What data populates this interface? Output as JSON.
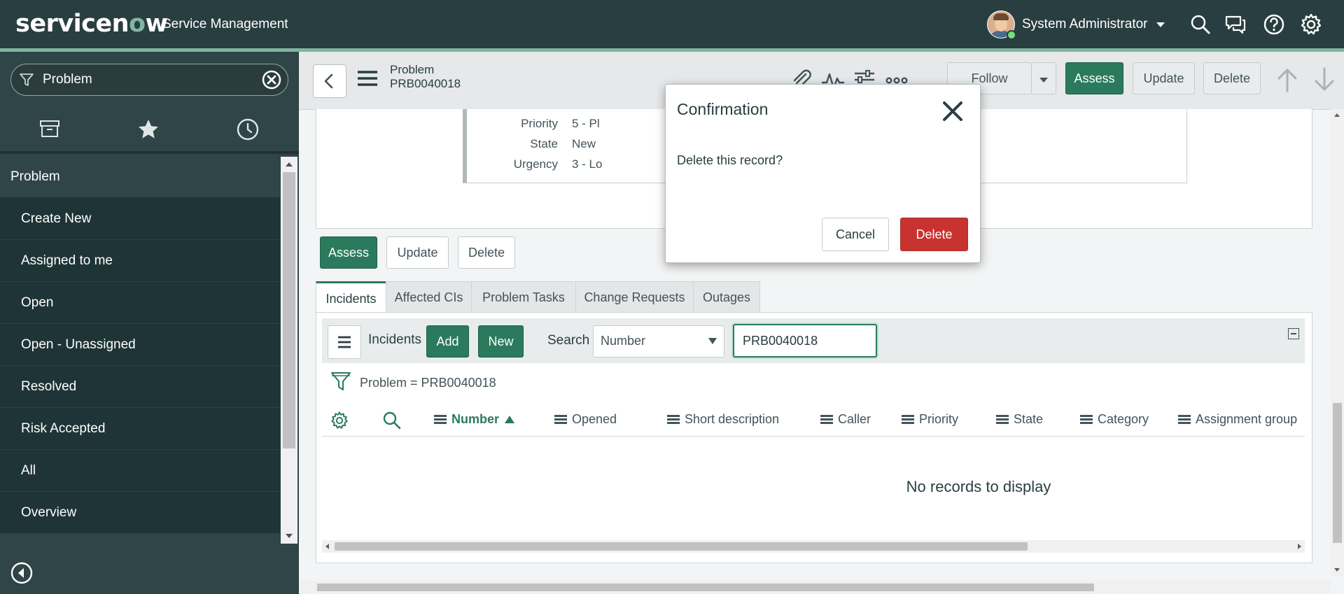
{
  "header": {
    "logo_text_pre": "servicen",
    "logo_text_o": "o",
    "logo_text_post": "w",
    "app_title": "Service Management",
    "user_name": "System Administrator"
  },
  "sidebar": {
    "filter_value": "Problem",
    "section_header": "Problem",
    "items": [
      {
        "label": "Create New"
      },
      {
        "label": "Assigned to me"
      },
      {
        "label": "Open"
      },
      {
        "label": "Open - Unassigned"
      },
      {
        "label": "Resolved"
      },
      {
        "label": "Risk Accepted"
      },
      {
        "label": "All"
      },
      {
        "label": "Overview"
      }
    ]
  },
  "record": {
    "table": "Problem",
    "number": "PRB0040018",
    "buttons": {
      "follow": "Follow",
      "assess": "Assess",
      "update": "Update",
      "delete": "Delete"
    },
    "fields": [
      {
        "label": "Priority",
        "value": "5 - Pl"
      },
      {
        "label": "State",
        "value": "New"
      },
      {
        "label": "Urgency",
        "value": "3 - Lo"
      }
    ]
  },
  "actions": {
    "assess": "Assess",
    "update": "Update",
    "delete": "Delete"
  },
  "related_tabs": [
    {
      "label": "Incidents"
    },
    {
      "label": "Affected CIs"
    },
    {
      "label": "Problem Tasks"
    },
    {
      "label": "Change Requests"
    },
    {
      "label": "Outages"
    }
  ],
  "list": {
    "title": "Incidents",
    "add_label": "Add",
    "new_label": "New",
    "search_label": "Search",
    "search_field": "Number",
    "search_value": "PRB0040018",
    "breadcrumb": "Problem = PRB0040018",
    "columns": [
      {
        "label": "Number"
      },
      {
        "label": "Opened"
      },
      {
        "label": "Short description"
      },
      {
        "label": "Caller"
      },
      {
        "label": "Priority"
      },
      {
        "label": "State"
      },
      {
        "label": "Category"
      },
      {
        "label": "Assignment group"
      }
    ],
    "empty_message": "No records to display"
  },
  "modal": {
    "title": "Confirmation",
    "body": "Delete this record?",
    "cancel_label": "Cancel",
    "delete_label": "Delete"
  },
  "colors": {
    "header_bg": "#293e40",
    "accent": "#81b5a1",
    "primary_button": "#2b7a5e",
    "danger_button": "#c8322f"
  }
}
